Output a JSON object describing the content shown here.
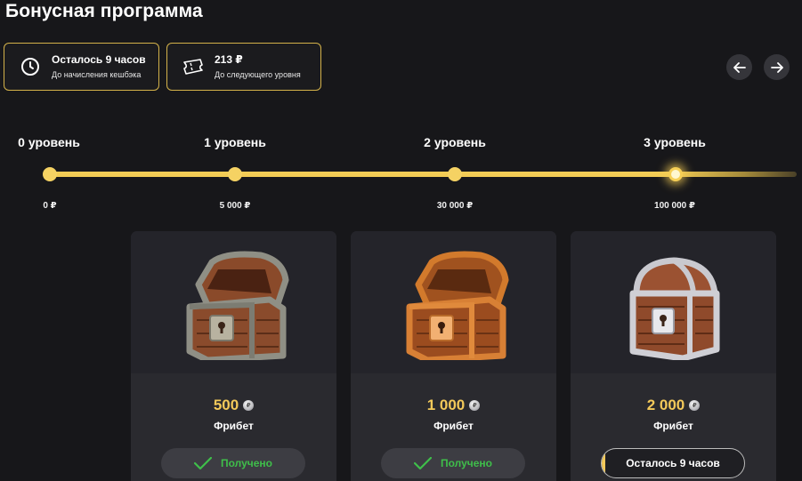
{
  "page": {
    "title": "Бонусная программа"
  },
  "info_cards": [
    {
      "icon": "clock-icon",
      "main": "Осталось 9 часов",
      "sub": "До начисления кешбэка"
    },
    {
      "icon": "ticket-icon",
      "main": "213 ₽",
      "sub": "До следующего уровня"
    }
  ],
  "levels": [
    {
      "label": "0 уровень",
      "amount": "0 ₽"
    },
    {
      "label": "1 уровень",
      "amount": "5 000 ₽"
    },
    {
      "label": "2 уровень",
      "amount": "30 000 ₽"
    },
    {
      "label": "3 уровень",
      "amount": "100 000 ₽"
    }
  ],
  "progress": {
    "current_level_index": 3
  },
  "cards": [
    {
      "chest": "stone-chest",
      "amount": "500",
      "coin": "₽",
      "kind": "Фрибет",
      "status": "Получено",
      "status_type": "received"
    },
    {
      "chest": "bronze-chest",
      "amount": "1 000",
      "coin": "₽",
      "kind": "Фрибет",
      "status": "Получено",
      "status_type": "received"
    },
    {
      "chest": "silver-chest",
      "amount": "2 000",
      "coin": "₽",
      "kind": "Фрибет",
      "status": "Осталось 9 часов",
      "status_type": "timer"
    }
  ],
  "colors": {
    "accent": "#f3c95a",
    "success": "#3fbf4a",
    "background": "#17171a",
    "card": "#2a2a2f"
  }
}
